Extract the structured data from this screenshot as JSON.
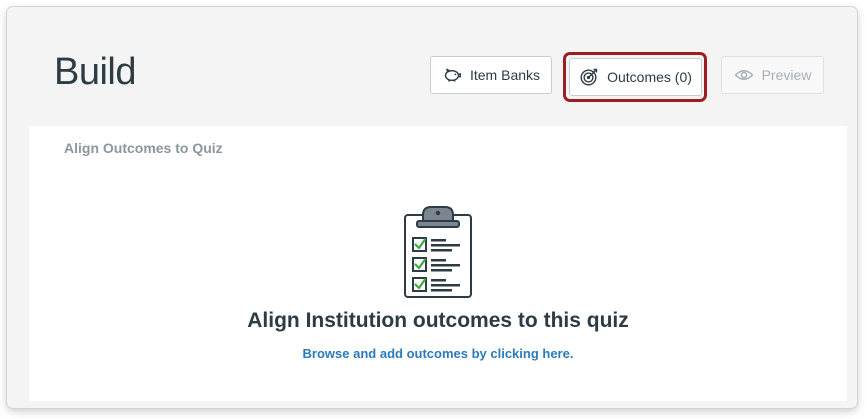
{
  "header": {
    "title": "Build",
    "buttons": {
      "item_banks": {
        "label": "Item Banks",
        "icon": "piggy-bank-icon"
      },
      "outcomes": {
        "label": "Outcomes (0)",
        "icon": "target-icon",
        "highlighted": true,
        "highlight_color": "#9d1d21"
      },
      "preview": {
        "label": "Preview",
        "icon": "eye-icon",
        "disabled": true
      }
    }
  },
  "panel": {
    "heading": "Align Outcomes to Quiz",
    "empty_state": {
      "illustration": "clipboard-checklist-icon",
      "title": "Align Institution outcomes to this quiz",
      "link_text": "Browse and add outcomes by clicking here."
    }
  },
  "colors": {
    "text_dark": "#2d3b45",
    "link_blue": "#2b7abc",
    "check_green": "#3eaa3e",
    "muted_gray": "#8b969e"
  }
}
